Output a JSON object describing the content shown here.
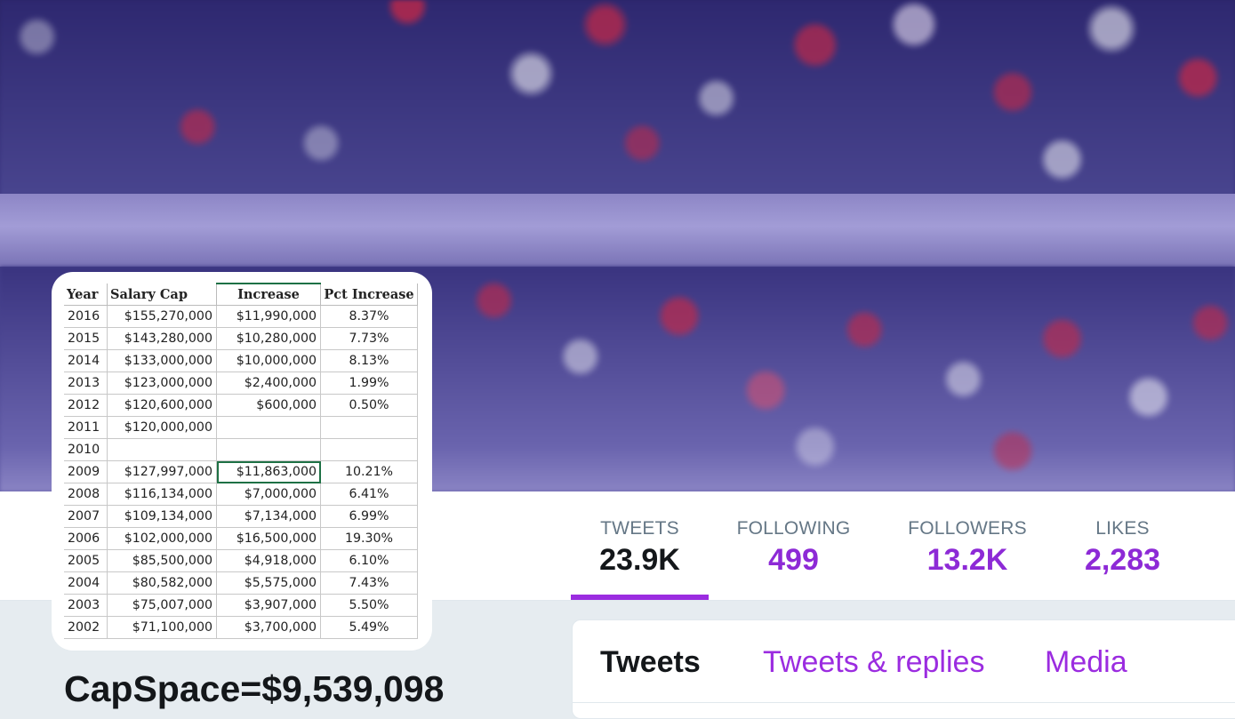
{
  "banner": {
    "image": "blurred-stadium-crowd"
  },
  "nav": {
    "stats": [
      {
        "label": "TWEETS",
        "value": "23.9K",
        "active": true
      },
      {
        "label": "FOLLOWING",
        "value": "499"
      },
      {
        "label": "FOLLOWERS",
        "value": "13.2K"
      },
      {
        "label": "LIKES",
        "value": "2,283"
      }
    ]
  },
  "avatar_table": {
    "headers": [
      "Year",
      "Salary Cap",
      "Increase",
      "Pct Increase"
    ],
    "rows": [
      [
        "2016",
        "$155,270,000",
        "$11,990,000",
        "8.37%"
      ],
      [
        "2015",
        "$143,280,000",
        "$10,280,000",
        "7.73%"
      ],
      [
        "2014",
        "$133,000,000",
        "$10,000,000",
        "8.13%"
      ],
      [
        "2013",
        "$123,000,000",
        "$2,400,000",
        "1.99%"
      ],
      [
        "2012",
        "$120,600,000",
        "$600,000",
        "0.50%"
      ],
      [
        "2011",
        "$120,000,000",
        "",
        ""
      ],
      [
        "2010",
        "",
        "",
        ""
      ],
      [
        "2009",
        "$127,997,000",
        "$11,863,000",
        "10.21%"
      ],
      [
        "2008",
        "$116,134,000",
        "$7,000,000",
        "6.41%"
      ],
      [
        "2007",
        "$109,134,000",
        "$7,134,000",
        "6.99%"
      ],
      [
        "2006",
        "$102,000,000",
        "$16,500,000",
        "19.30%"
      ],
      [
        "2005",
        "$85,500,000",
        "$4,918,000",
        "6.10%"
      ],
      [
        "2004",
        "$80,582,000",
        "$5,575,000",
        "7.43%"
      ],
      [
        "2003",
        "$75,007,000",
        "$3,907,000",
        "5.50%"
      ],
      [
        "2002",
        "$71,100,000",
        "$3,700,000",
        "5.49%"
      ]
    ]
  },
  "profile": {
    "name": "CapSpace=$9,539,098"
  },
  "tabs": [
    {
      "label": "Tweets",
      "active": true
    },
    {
      "label": "Tweets & replies"
    },
    {
      "label": "Media"
    }
  ],
  "colors": {
    "accent": "#9b2ce0",
    "text": "#14171a",
    "muted": "#657786"
  }
}
